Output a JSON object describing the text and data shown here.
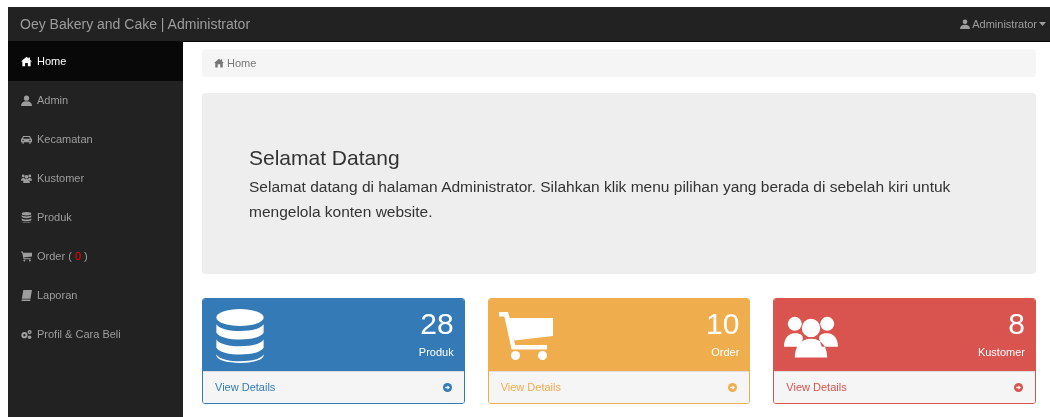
{
  "navbar": {
    "brand": "Oey Bakery and Cake | Administrator",
    "user_menu": "Administrator"
  },
  "sidebar": {
    "items": [
      {
        "label": "Home",
        "selected": true
      },
      {
        "label": "Admin",
        "selected": false
      },
      {
        "label": "Kecamatan",
        "selected": false
      },
      {
        "label": "Kustomer",
        "selected": false
      },
      {
        "label": "Produk",
        "selected": false
      },
      {
        "label": "Order (",
        "badge": "0",
        "label_end": ")",
        "selected": false
      },
      {
        "label": "Laporan",
        "selected": false
      },
      {
        "label": "Profil & Cara Beli",
        "selected": false
      }
    ]
  },
  "breadcrumb": {
    "label": "Home"
  },
  "welcome": {
    "title": "Selamat Datang",
    "text": "Selamat datang di halaman Administrator. Silahkan klik menu pilihan yang berada di sebelah kiri untuk mengelola konten website."
  },
  "panels": [
    {
      "count": "28",
      "label": "Produk",
      "color": "#337ab7",
      "link": "View Details"
    },
    {
      "count": "10",
      "label": "Order",
      "color": "#f0ad4e",
      "link": "View Details"
    },
    {
      "count": "8",
      "label": "Kustomer",
      "color": "#d9534f",
      "link": "View Details"
    }
  ]
}
